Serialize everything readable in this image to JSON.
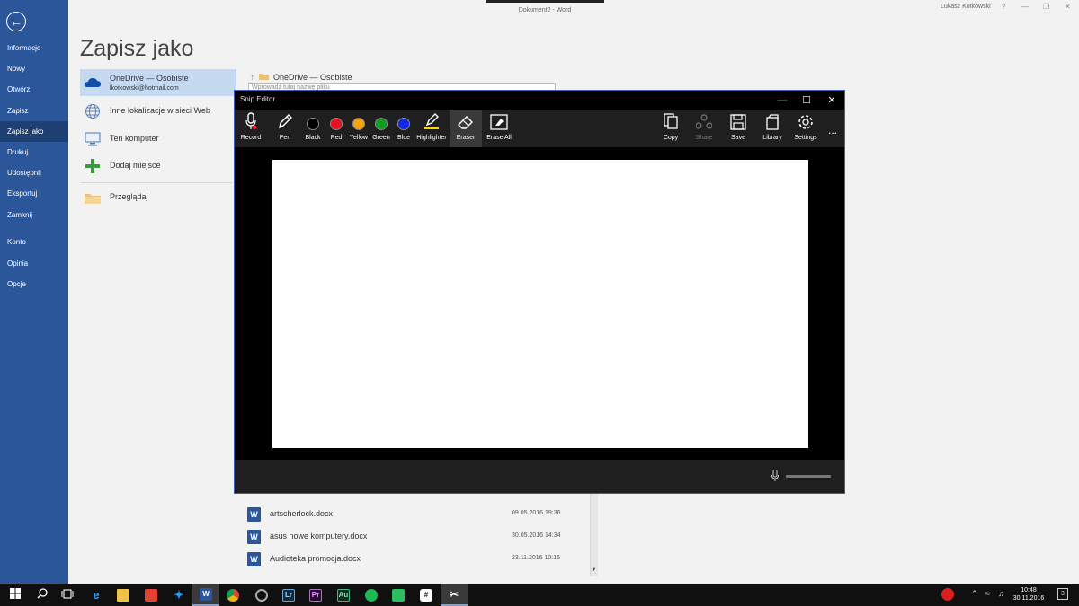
{
  "word": {
    "window_title": "Dokument2 - Word",
    "user_name": "Łukasz Kotkowski",
    "help": "?",
    "page_title": "Zapisz jako",
    "nav": [
      {
        "label": "Informacje"
      },
      {
        "label": "Nowy"
      },
      {
        "label": "Otwórz"
      },
      {
        "label": "Zapisz"
      },
      {
        "label": "Zapisz jako",
        "active": true
      },
      {
        "label": "Drukuj"
      },
      {
        "label": "Udostępnij"
      },
      {
        "label": "Eksportuj"
      },
      {
        "label": "Zamknij"
      },
      {
        "label": "Konto"
      },
      {
        "label": "Opinia"
      },
      {
        "label": "Opcje"
      }
    ],
    "locations": [
      {
        "label": "OneDrive — Osobiste",
        "sub": "lkotkowski@hotmail.com",
        "icon": "cloud-icon",
        "active": true
      },
      {
        "label": "Inne lokalizacje w sieci Web",
        "icon": "globe-icon"
      },
      {
        "label": "Ten komputer",
        "icon": "computer-icon"
      },
      {
        "label": "Dodaj miejsce",
        "icon": "plus-icon"
      },
      {
        "label": "Przeglądaj",
        "icon": "folder-icon"
      }
    ],
    "breadcrumb": "OneDrive — Osobiste",
    "filename_placeholder": "Wprowadź tutaj nazwę pliku",
    "files": [
      {
        "name": "artscherlock.docx",
        "date": "09.05.2016 19:36"
      },
      {
        "name": "asus nowe komputery.docx",
        "date": "30.05.2016 14:34"
      },
      {
        "name": "Audioteka promocja.docx",
        "date": "23.11.2016 10:16"
      }
    ]
  },
  "snip": {
    "title": "Snip Editor",
    "tools": [
      {
        "label": "Record",
        "icon": "microphone-icon"
      },
      {
        "label": "Pen",
        "icon": "pen-icon"
      },
      {
        "label": "Black",
        "color": "#000000"
      },
      {
        "label": "Red",
        "color": "#e81123"
      },
      {
        "label": "Yellow",
        "color": "#f7a10d"
      },
      {
        "label": "Green",
        "color": "#0f9d1f"
      },
      {
        "label": "Blue",
        "color": "#1226e6"
      },
      {
        "label": "Highlighter",
        "icon": "highlighter-icon"
      },
      {
        "label": "Eraser",
        "icon": "eraser-icon",
        "selected": true
      },
      {
        "label": "Erase All",
        "icon": "erase-all-icon"
      }
    ],
    "actions": [
      {
        "label": "Copy",
        "icon": "copy-icon"
      },
      {
        "label": "Share",
        "icon": "share-icon",
        "disabled": true
      },
      {
        "label": "Save",
        "icon": "save-icon"
      },
      {
        "label": "Library",
        "icon": "library-icon"
      },
      {
        "label": "Settings",
        "icon": "gear-icon"
      }
    ],
    "more": "..."
  },
  "taskbar": {
    "time": "10:48",
    "date": "30.11.2016",
    "notification_count": "3"
  }
}
